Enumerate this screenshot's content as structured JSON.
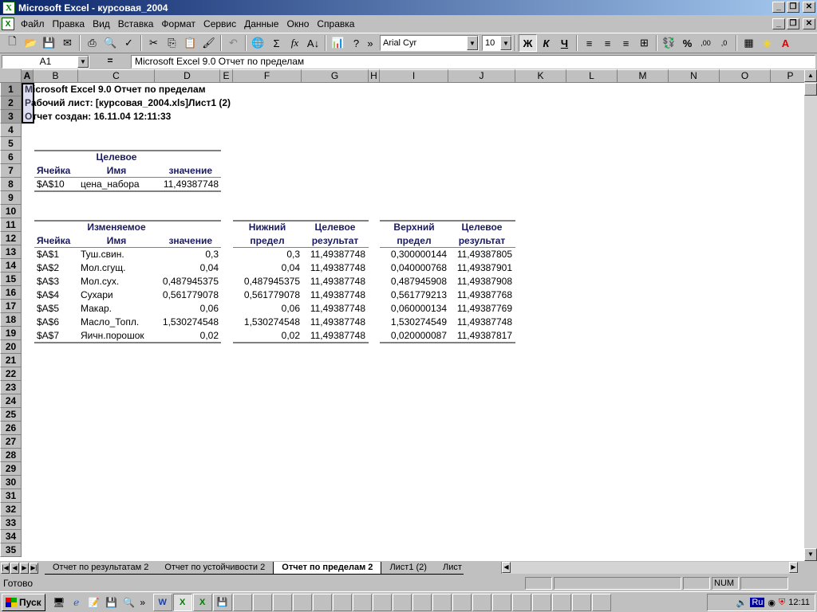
{
  "window": {
    "title": "Microsoft Excel - курсовая_2004"
  },
  "menu": [
    "Файл",
    "Правка",
    "Вид",
    "Вставка",
    "Формат",
    "Сервис",
    "Данные",
    "Окно",
    "Справка"
  ],
  "toolbar": {
    "font_name": "Arial Cyr",
    "font_size": "10",
    "bold": "Ж",
    "italic": "К",
    "underline": "Ч",
    "sum": "Σ",
    "fx": "fx",
    "percent": "%"
  },
  "formula": {
    "cell_ref": "A1",
    "eq": "=",
    "content": "Microsoft Excel 9.0 Отчет по пределам"
  },
  "columns": [
    "A",
    "B",
    "C",
    "D",
    "E",
    "F",
    "G",
    "H",
    "I",
    "J",
    "K",
    "L",
    "M",
    "N",
    "O",
    "P"
  ],
  "rows": [
    "1",
    "2",
    "3",
    "4",
    "5",
    "6",
    "7",
    "8",
    "9",
    "10",
    "11",
    "12",
    "13",
    "14",
    "15",
    "16",
    "17",
    "18",
    "19",
    "20",
    "21",
    "22",
    "23",
    "24",
    "25",
    "26",
    "27",
    "28",
    "29",
    "30",
    "31",
    "32",
    "33",
    "34",
    "35"
  ],
  "report": {
    "line1": "Microsoft Excel 9.0 Отчет по пределам",
    "line2": "Рабочий лист: [курсовая_2004.xls]Лист1 (2)",
    "line3": "Отчет создан: 16.11.04 12:11:33"
  },
  "target": {
    "hdr_top": "Целевое",
    "hdr_cell": "Ячейка",
    "hdr_name": "Имя",
    "hdr_value": "значение",
    "cell": "$A$10",
    "name": "цена_набора",
    "value": "11,49387748"
  },
  "vars_header": {
    "hdr_top": "Изменяемое",
    "hdr_cell": "Ячейка",
    "hdr_name": "Имя",
    "hdr_value": "значение",
    "lower_top": "Нижний",
    "lower_bot": "предел",
    "lres_top": "Целевое",
    "lres_bot": "результат",
    "upper_top": "Верхний",
    "upper_bot": "предел",
    "ures_top": "Целевое",
    "ures_bot": "результат"
  },
  "vars": [
    {
      "cell": "$A$1",
      "name": "Туш.свин.",
      "value": "0,3",
      "lower": "0,3",
      "lres": "11,49387748",
      "upper": "0,300000144",
      "ures": "11,49387805"
    },
    {
      "cell": "$A$2",
      "name": "Мол.сгущ.",
      "value": "0,04",
      "lower": "0,04",
      "lres": "11,49387748",
      "upper": "0,040000768",
      "ures": "11,49387901"
    },
    {
      "cell": "$A$3",
      "name": "Мол.сух.",
      "value": "0,487945375",
      "lower": "0,487945375",
      "lres": "11,49387748",
      "upper": "0,487945908",
      "ures": "11,49387908"
    },
    {
      "cell": "$A$4",
      "name": "Сухари",
      "value": "0,561779078",
      "lower": "0,561779078",
      "lres": "11,49387748",
      "upper": "0,561779213",
      "ures": "11,49387768"
    },
    {
      "cell": "$A$5",
      "name": "Макар.",
      "value": "0,06",
      "lower": "0,06",
      "lres": "11,49387748",
      "upper": "0,060000134",
      "ures": "11,49387769"
    },
    {
      "cell": "$A$6",
      "name": "Масло_Топл.",
      "value": "1,530274548",
      "lower": "1,530274548",
      "lres": "11,49387748",
      "upper": "1,530274549",
      "ures": "11,49387748"
    },
    {
      "cell": "$A$7",
      "name": "Яичн.порошок",
      "value": "0,02",
      "lower": "0,02",
      "lres": "11,49387748",
      "upper": "0,020000087",
      "ures": "11,49387817"
    }
  ],
  "tabs": [
    "Отчет по результатам 2",
    "Отчет по устойчивости 2",
    "Отчет по пределам 2",
    "Лист1 (2)",
    "Лист"
  ],
  "status": {
    "text": "Готово",
    "num": "NUM"
  },
  "taskbar": {
    "start": "Пуск",
    "clock": "12:11",
    "lang": "Ru"
  }
}
